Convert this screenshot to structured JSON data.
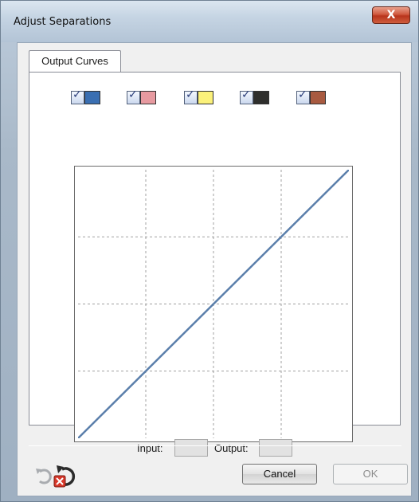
{
  "window": {
    "title": "Adjust Separations",
    "close_label": "X"
  },
  "tabs": [
    {
      "label": "Output Curves"
    }
  ],
  "separations": [
    {
      "name": "cyan",
      "checked": true,
      "color": "#3a6fb2"
    },
    {
      "name": "magenta",
      "checked": true,
      "color": "#e79aa0"
    },
    {
      "name": "yellow",
      "checked": true,
      "color": "#fbf17a"
    },
    {
      "name": "black",
      "checked": true,
      "color": "#2e2e2c"
    },
    {
      "name": "brown",
      "checked": true,
      "color": "#a85a40"
    }
  ],
  "checkmark": "✓",
  "curve": {
    "grid_divisions": 4,
    "line_color": "#5b7fab",
    "points": [
      [
        0,
        0
      ],
      [
        1,
        1
      ]
    ]
  },
  "io": {
    "input_label": "Input:",
    "input_value": "",
    "output_label": "Output:",
    "output_value": ""
  },
  "buttons": {
    "cancel": "Cancel",
    "ok": "OK"
  },
  "icons": {
    "undo": "undo-icon",
    "reset": "reset-icon"
  }
}
